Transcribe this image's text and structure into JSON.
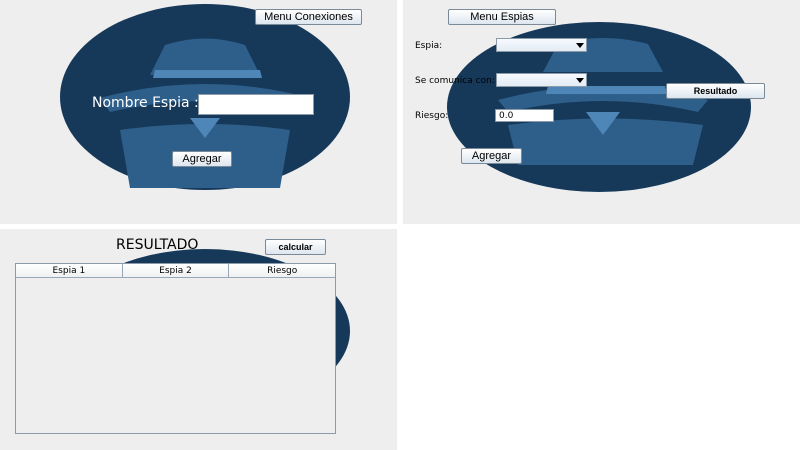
{
  "colors": {
    "panel_bg": "#eeeeee",
    "logo_outer": "#16395a",
    "logo_inner": "#2d5f8a",
    "logo_light": "#4f86b8"
  },
  "window_conexiones": {
    "menu_button": "Menu Conexiones",
    "name_label": "Nombre Espia :",
    "name_value": "",
    "add_button": "Agregar"
  },
  "window_espias": {
    "menu_button": "Menu Espias",
    "espia_label": "Espia:",
    "espia_value": "",
    "comunica_label": "Se comunica con:",
    "comunica_value": "",
    "riesgo_label": "Riesgo:",
    "riesgo_value": "0.0",
    "resultado_button": "Resultado",
    "add_button": "Agregar"
  },
  "window_resultado": {
    "title": "RESULTADO",
    "calc_button": "calcular",
    "columns": [
      "Espia 1",
      "Espia 2",
      "Riesgo"
    ]
  },
  "icons": [
    "spy-logo-icon",
    "dropdown-arrow-icon"
  ]
}
